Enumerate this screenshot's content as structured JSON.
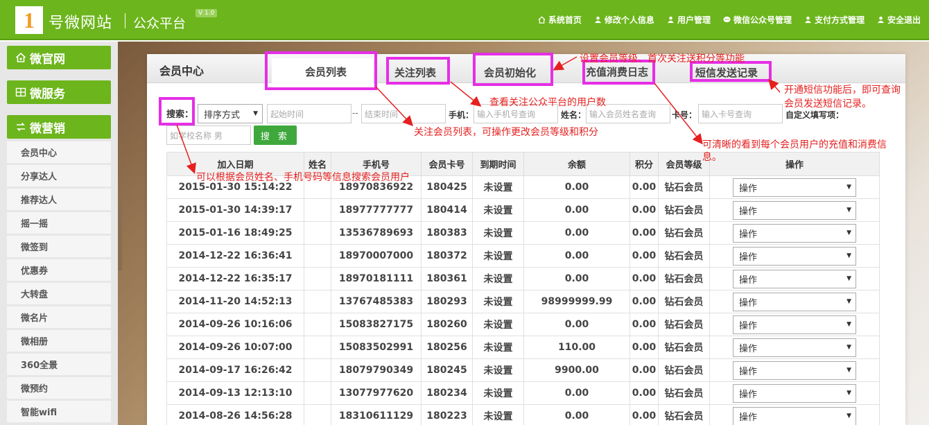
{
  "header": {
    "logo_number": "1",
    "logo_text": "号微网站",
    "logo_sub": "公众平台",
    "version": "V 1.0",
    "nav": [
      {
        "label": "系统首页",
        "icon": "home-icon"
      },
      {
        "label": "修改个人信息",
        "icon": "user-icon"
      },
      {
        "label": "用户管理",
        "icon": "user-icon"
      },
      {
        "label": "微信公众号管理",
        "icon": "chat-icon"
      },
      {
        "label": "支付方式管理",
        "icon": "user-icon"
      },
      {
        "label": "安全退出",
        "icon": "user-icon"
      }
    ]
  },
  "sidebar": {
    "categories": [
      {
        "label": "微官网",
        "icon": "home-icon"
      },
      {
        "label": "微服务",
        "icon": "grid-icon"
      },
      {
        "label": "微营销",
        "icon": "exchange-icon"
      }
    ],
    "items": [
      "会员中心",
      "分享达人",
      "推荐达人",
      "摇一摇",
      "微签到",
      "优惠券",
      "大转盘",
      "微名片",
      "微相册",
      "360全景",
      "微预约",
      "智能wifi"
    ]
  },
  "panel": {
    "title": "会员中心",
    "tabs": [
      "会员列表",
      "关注列表",
      "会员初始化",
      "充值消费日志",
      "短信发送记录"
    ]
  },
  "search": {
    "label": "搜索：",
    "sort_value": "排序方式",
    "start_placeholder": "起始时间",
    "sep": "--",
    "end_placeholder": "结束时间",
    "phone_label": "手机：",
    "phone_placeholder": "输入手机号查询",
    "name_label": "姓名：",
    "name_placeholder": "输入会员姓名查询",
    "card_label": "卡号：",
    "card_placeholder": "输入卡号查询",
    "custom_label": "自定义填写项：",
    "school_placeholder": "如学校名称 男",
    "button": "搜 索"
  },
  "table": {
    "columns": [
      "加入日期",
      "姓名",
      "手机号",
      "会员卡号",
      "到期时间",
      "余额",
      "积分",
      "会员等级",
      "操作"
    ],
    "rows": [
      {
        "date": "2015-01-30 15:14:22",
        "name": "",
        "phone": "18970836922",
        "card": "180425",
        "expire": "未设置",
        "balance": "0.00",
        "points": "0.00",
        "level": "钻石会员",
        "op": "操作"
      },
      {
        "date": "2015-01-30 14:39:17",
        "name": "",
        "phone": "18977777777",
        "card": "180414",
        "expire": "未设置",
        "balance": "0.00",
        "points": "0.00",
        "level": "钻石会员",
        "op": "操作"
      },
      {
        "date": "2015-01-16 18:49:25",
        "name": "",
        "phone": "13536789693",
        "card": "180383",
        "expire": "未设置",
        "balance": "0.00",
        "points": "0.00",
        "level": "钻石会员",
        "op": "操作"
      },
      {
        "date": "2014-12-22 16:36:41",
        "name": "",
        "phone": "18970007000",
        "card": "180372",
        "expire": "未设置",
        "balance": "0.00",
        "points": "0.00",
        "level": "钻石会员",
        "op": "操作"
      },
      {
        "date": "2014-12-22 16:35:17",
        "name": "",
        "phone": "18970181111",
        "card": "180361",
        "expire": "未设置",
        "balance": "0.00",
        "points": "0.00",
        "level": "钻石会员",
        "op": "操作"
      },
      {
        "date": "2014-11-20 14:52:13",
        "name": "",
        "phone": "13767485383",
        "card": "180293",
        "expire": "未设置",
        "balance": "98999999.99",
        "points": "0.00",
        "level": "钻石会员",
        "op": "操作"
      },
      {
        "date": "2014-09-26 10:16:06",
        "name": "",
        "phone": "15083827175",
        "card": "180260",
        "expire": "未设置",
        "balance": "0.00",
        "points": "0.00",
        "level": "钻石会员",
        "op": "操作"
      },
      {
        "date": "2014-09-26 10:07:00",
        "name": "",
        "phone": "15083502991",
        "card": "180256",
        "expire": "未设置",
        "balance": "110.00",
        "points": "0.00",
        "level": "钻石会员",
        "op": "操作"
      },
      {
        "date": "2014-09-17 16:26:42",
        "name": "",
        "phone": "18079790349",
        "card": "180245",
        "expire": "未设置",
        "balance": "9900.00",
        "points": "0.00",
        "level": "钻石会员",
        "op": "操作"
      },
      {
        "date": "2014-09-13 12:13:10",
        "name": "",
        "phone": "13077977620",
        "card": "180234",
        "expire": "未设置",
        "balance": "0.00",
        "points": "0.00",
        "level": "钻石会员",
        "op": "操作"
      },
      {
        "date": "2014-08-26 14:56:28",
        "name": "",
        "phone": "18310611129",
        "card": "180223",
        "expire": "未设置",
        "balance": "0.00",
        "points": "0.00",
        "level": "钻石会员",
        "op": "操作"
      }
    ]
  },
  "annotations": {
    "init": "设置会员等级、首次关注送积分等功能",
    "follow": "查看关注公众平台的用户数",
    "sms": "开通短信功能后，即可查询\n会员发送短信记录。",
    "members": "关注会员列表，可操作更改会员等级和积分",
    "recharge": "可清晰的看到每个会员用户的充值和消费信\n息。",
    "search": "可以根据会员姓名、手机号码等信息搜索会员用户"
  },
  "colors": {
    "brand": "#6cb51c",
    "highlight": "#e62ee6",
    "annotation": "#e62020",
    "balance": "#f0700a",
    "link": "#1a7bbd"
  }
}
